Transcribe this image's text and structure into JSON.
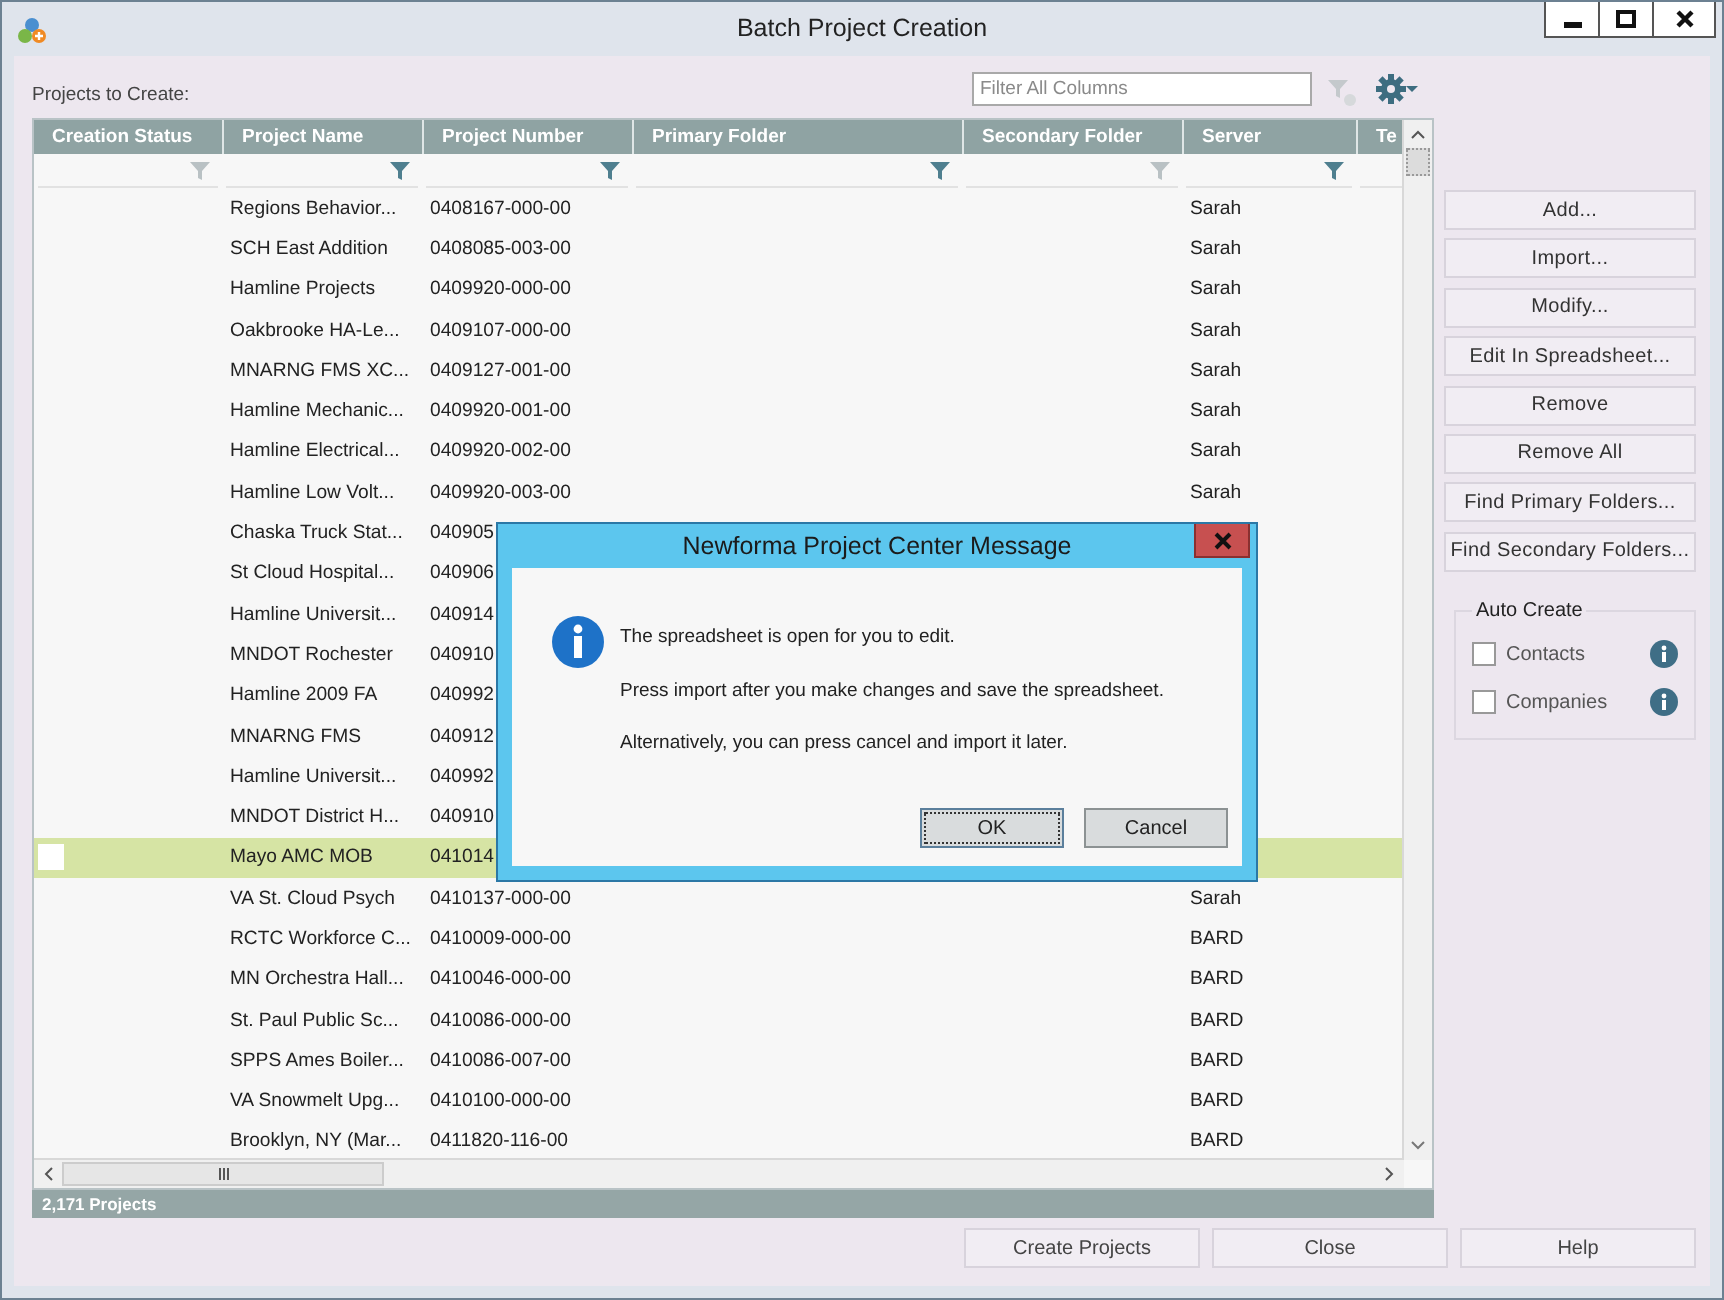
{
  "window": {
    "title": "Batch Project Creation"
  },
  "projects_label": "Projects to Create:",
  "filter": {
    "placeholder": "Filter All Columns"
  },
  "table": {
    "columns": [
      {
        "label": "Creation Status",
        "filter_enabled": false
      },
      {
        "label": "Project Name",
        "filter_enabled": true
      },
      {
        "label": "Project Number",
        "filter_enabled": true
      },
      {
        "label": "Primary Folder",
        "filter_enabled": true
      },
      {
        "label": "Secondary Folder",
        "filter_enabled": false
      },
      {
        "label": "Server",
        "filter_enabled": true
      },
      {
        "label": "Te"
      }
    ],
    "rows": [
      {
        "name": "Regions Behavior...",
        "number": "0408167-000-00",
        "server": "Sarah",
        "selected": false
      },
      {
        "name": "SCH East Addition",
        "number": "0408085-003-00",
        "server": "Sarah",
        "selected": false
      },
      {
        "name": "Hamline Projects",
        "number": "0409920-000-00",
        "server": "Sarah",
        "selected": false
      },
      {
        "name": "Oakbrooke HA-Le...",
        "number": "0409107-000-00",
        "server": "Sarah",
        "selected": false
      },
      {
        "name": "MNARNG FMS XC...",
        "number": "0409127-001-00",
        "server": "Sarah",
        "selected": false
      },
      {
        "name": "Hamline Mechanic...",
        "number": "0409920-001-00",
        "server": "Sarah",
        "selected": false
      },
      {
        "name": "Hamline Electrical...",
        "number": "0409920-002-00",
        "server": "Sarah",
        "selected": false
      },
      {
        "name": "Hamline Low Volt...",
        "number": "0409920-003-00",
        "server": "Sarah",
        "selected": false
      },
      {
        "name": "Chaska Truck Stat...",
        "number": "040905",
        "selected": false
      },
      {
        "name": "St Cloud Hospital...",
        "number": "040906",
        "selected": false
      },
      {
        "name": "Hamline Universit...",
        "number": "040914",
        "selected": false
      },
      {
        "name": "MNDOT Rochester",
        "number": "040910",
        "selected": false
      },
      {
        "name": "Hamline 2009 FA",
        "number": "040992",
        "selected": false
      },
      {
        "name": "MNARNG FMS",
        "number": "040912",
        "selected": false
      },
      {
        "name": "Hamline Universit...",
        "number": "040992",
        "selected": false
      },
      {
        "name": "MNDOT District H...",
        "number": "040910",
        "selected": false
      },
      {
        "name": "Mayo AMC MOB",
        "number": "041014",
        "selected": true
      },
      {
        "name": "VA St. Cloud Psych",
        "number": "0410137-000-00",
        "server": "Sarah",
        "selected": false
      },
      {
        "name": "RCTC Workforce C...",
        "number": "0410009-000-00",
        "server": "BARD",
        "selected": false
      },
      {
        "name": "MN Orchestra Hall...",
        "number": "0410046-000-00",
        "server": "BARD",
        "selected": false
      },
      {
        "name": "St. Paul Public Sc...",
        "number": "0410086-000-00",
        "server": "BARD",
        "selected": false
      },
      {
        "name": "SPPS Ames Boiler...",
        "number": "0410086-007-00",
        "server": "BARD",
        "selected": false
      },
      {
        "name": "VA Snowmelt Upg...",
        "number": "0410100-000-00",
        "server": "BARD",
        "selected": false
      },
      {
        "name": "Brooklyn, NY (Mar...",
        "number": "0411820-116-00",
        "server": "BARD",
        "selected": false
      }
    ]
  },
  "status_bar": "2,171 Projects",
  "actions": [
    "Add...",
    "Import...",
    "Modify...",
    "Edit In Spreadsheet...",
    "Remove",
    "Remove All",
    "Find Primary Folders...",
    "Find Secondary Folders..."
  ],
  "auto_create": {
    "title": "Auto Create",
    "options": [
      {
        "label": "Contacts",
        "checked": false
      },
      {
        "label": "Companies",
        "checked": false
      }
    ]
  },
  "footer_buttons": [
    "Create Projects",
    "Close",
    "Help"
  ],
  "dialog": {
    "title": "Newforma Project Center Message",
    "lines": [
      "The spreadsheet is open for you to edit.",
      "Press import after you make changes and save the spreadsheet.",
      "Alternatively, you can press cancel and import it later."
    ],
    "buttons": [
      {
        "label": "OK",
        "focused": true
      },
      {
        "label": "Cancel",
        "focused": false
      }
    ]
  }
}
